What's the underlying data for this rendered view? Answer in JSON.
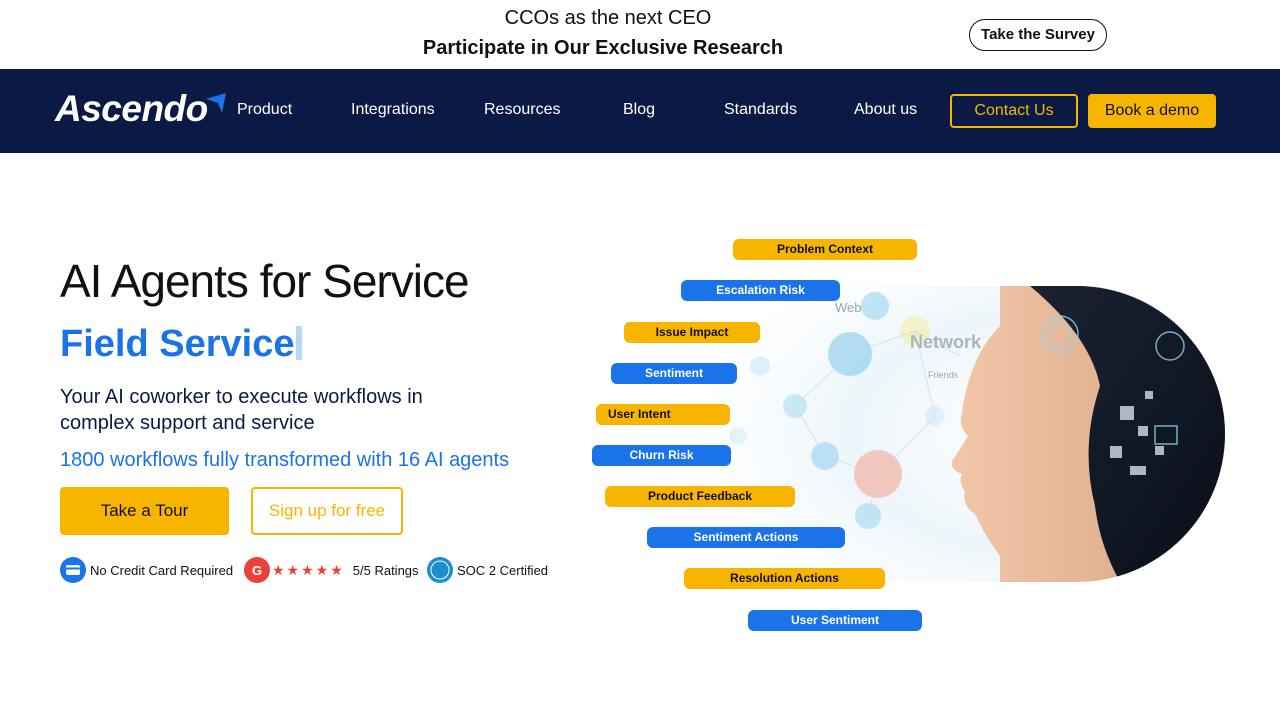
{
  "announcement": {
    "line1": "CCOs as the next CEO",
    "line2": "Participate in Our Exclusive Research",
    "survey_button": "Take the Survey"
  },
  "nav": {
    "logo": "Ascendo",
    "links": [
      "Product",
      "Integrations",
      "Resources",
      "Blog",
      "Standards",
      "About us"
    ],
    "contact_button": "Contact Us",
    "demo_button": "Book a demo"
  },
  "hero": {
    "title": "AI Agents for Service",
    "rotating_text": "Field Service",
    "subtitle": "Your AI coworker to execute workflows in complex support and service",
    "stat": "1800 workflows fully transformed with 16 AI agents",
    "tour_button": "Take a Tour",
    "signup_button": "Sign up for free"
  },
  "badges": {
    "no_card": "No Credit Card Required",
    "ratings": "5/5 Ratings",
    "soc": "SOC 2 Certified"
  },
  "illustration": {
    "tags": [
      {
        "label": "Problem Context",
        "color": "yellow"
      },
      {
        "label": "Escalation Risk",
        "color": "blue"
      },
      {
        "label": "Issue Impact",
        "color": "yellow"
      },
      {
        "label": "Sentiment",
        "color": "blue"
      },
      {
        "label": "User Intent",
        "color": "yellow"
      },
      {
        "label": "Churn Risk",
        "color": "blue"
      },
      {
        "label": "Product Feedback",
        "color": "yellow"
      },
      {
        "label": "Sentiment Actions",
        "color": "blue"
      },
      {
        "label": "Resolution Actions",
        "color": "yellow"
      },
      {
        "label": "User Sentiment",
        "color": "blue"
      }
    ],
    "network_words": [
      "Web",
      "Network",
      "Friends"
    ]
  },
  "colors": {
    "navy": "#0b1a45",
    "accent_yellow": "#f7b500",
    "accent_blue": "#1a73e8"
  }
}
